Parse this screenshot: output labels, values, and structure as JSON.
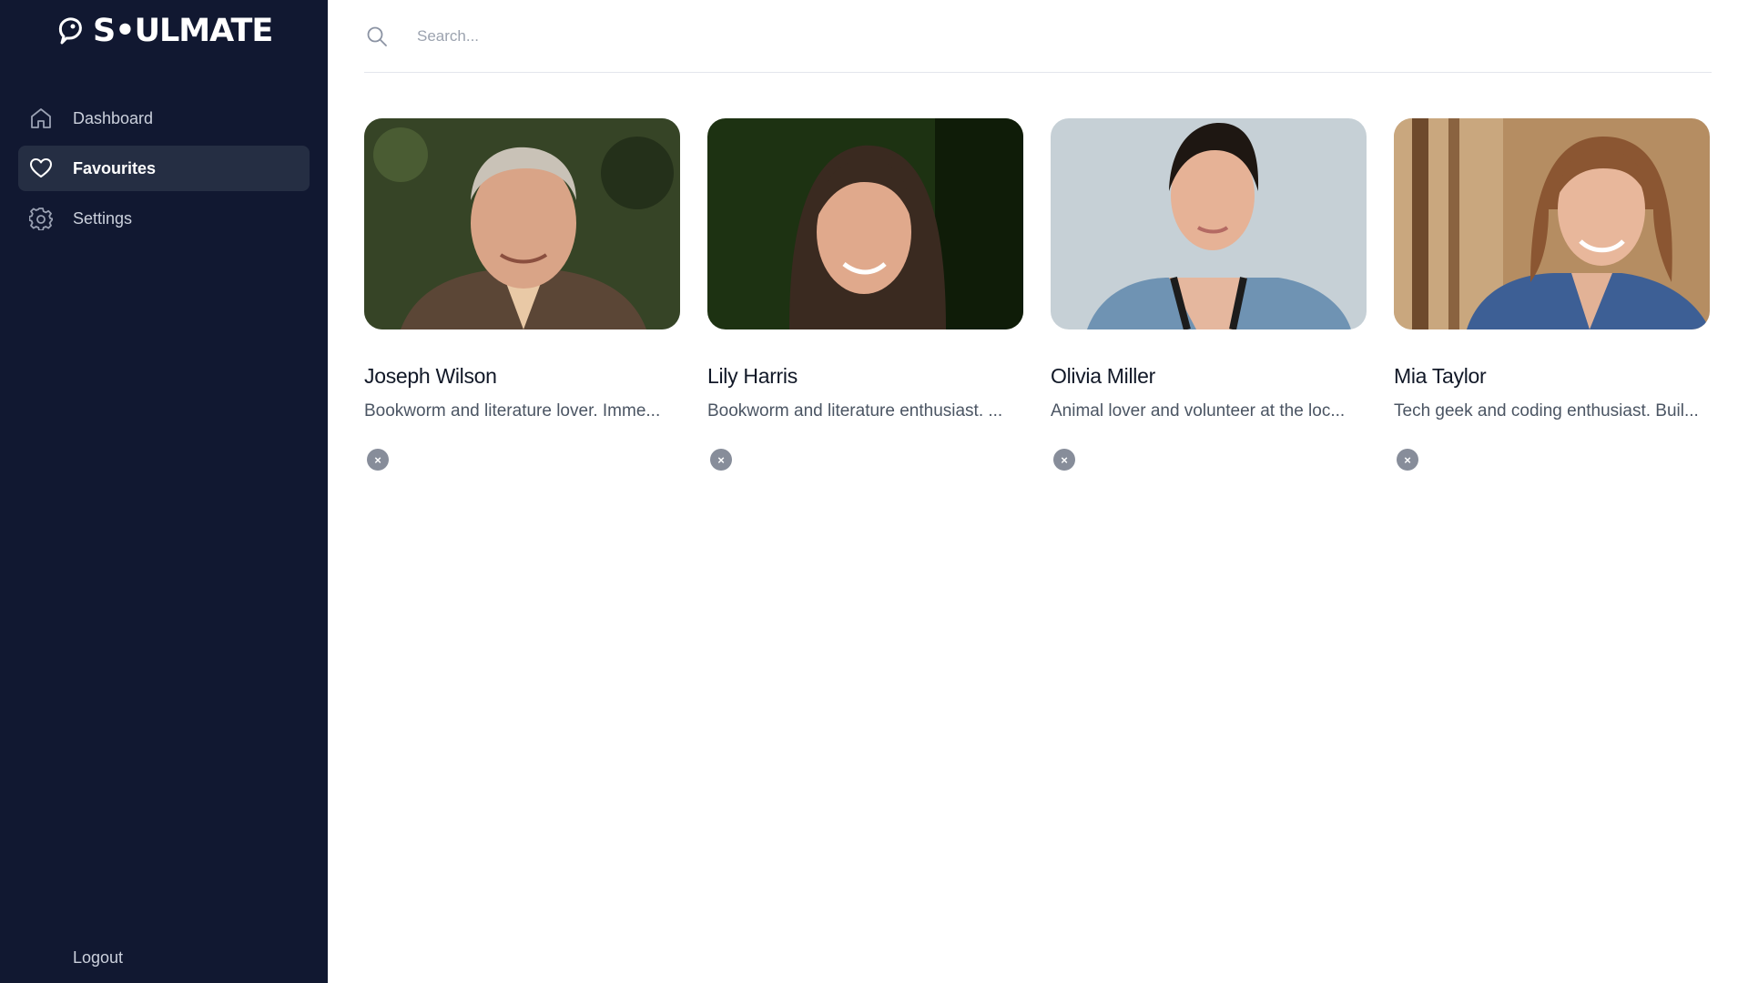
{
  "app": {
    "logo_text": "S•ULMATE"
  },
  "sidebar": {
    "items": [
      {
        "label": "Dashboard",
        "icon": "home-icon",
        "active": false
      },
      {
        "label": "Favourites",
        "icon": "heart-icon",
        "active": true
      },
      {
        "label": "Settings",
        "icon": "gear-icon",
        "active": false
      }
    ],
    "logout_label": "Logout"
  },
  "search": {
    "placeholder": "Search...",
    "value": ""
  },
  "favourites": [
    {
      "name": "Joseph Wilson",
      "description": "Bookworm and literature lover. Imme..."
    },
    {
      "name": "Lily Harris",
      "description": "Bookworm and literature enthusiast. ..."
    },
    {
      "name": "Olivia Miller",
      "description": "Animal lover and volunteer at the loc..."
    },
    {
      "name": "Mia Taylor",
      "description": "Tech geek and coding enthusiast. Buil..."
    }
  ],
  "remove_icon": "×",
  "colors": {
    "sidebar_bg": "#111831",
    "active_item_bg": "#252e43",
    "remove_button": "#878d9a"
  }
}
